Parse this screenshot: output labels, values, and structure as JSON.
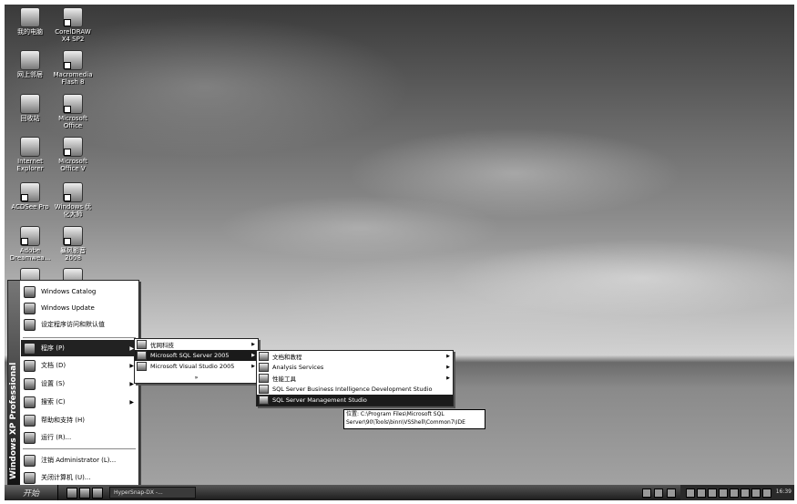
{
  "desktop": {
    "icons": [
      {
        "label": "我的电脑"
      },
      {
        "label": "CorelDRAW\nX4 SP2"
      },
      {
        "label": "网上邻居"
      },
      {
        "label": "Macromedia\nFlash 8"
      },
      {
        "label": "回收站"
      },
      {
        "label": "Microsoft\nOffice"
      },
      {
        "label": "Internet\nExplorer"
      },
      {
        "label": "Microsoft\nOffice V"
      },
      {
        "label": "ACDSee Pro"
      },
      {
        "label": "Windows 优\n化大师"
      },
      {
        "label": "Adobe\nDreamwea..."
      },
      {
        "label": "暴风影音\n2008"
      },
      {
        "label": ""
      },
      {
        "label": ""
      }
    ]
  },
  "start_menu": {
    "band_text": "Windows XP Professional",
    "top_items": [
      "Windows Catalog",
      "Windows Update",
      "设定程序访问和默认值"
    ],
    "main_items": [
      "程序 (P)",
      "文档 (D)",
      "设置 (S)",
      "搜索 (C)",
      "帮助和支持 (H)",
      "运行 (R)..."
    ],
    "bottom_items": [
      "注销 Administrator (L)...",
      "关闭计算机 (U)..."
    ]
  },
  "programs_menu": {
    "items": [
      "优网科技",
      "Microsoft SQL Server 2005",
      "Microsoft Visual Studio 2005",
      "»"
    ]
  },
  "sql_menu": {
    "items": [
      "文档和教程",
      "Analysis Services",
      "性能工具",
      "SQL Server Business Intelligence Development Studio",
      "SQL Server Management Studio"
    ]
  },
  "tooltip": {
    "text": "位置: C:\\Program Files\\Microsoft SQL Server\\90\\Tools\\binn\\VSShell\\Common7\\IDE"
  },
  "taskbar": {
    "start_label": "开始",
    "task_label": "HyperSnap-DX -...",
    "clock": "16:39"
  },
  "colors": {
    "taskbar": "#1c1c1c",
    "highlight": "#1a1a1a"
  }
}
